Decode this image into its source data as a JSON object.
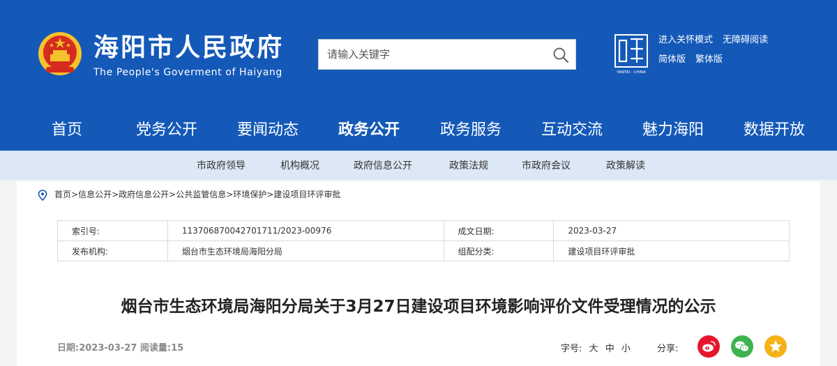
{
  "header": {
    "title": "海阳市人民政府",
    "subtitle": "The People's Goverment of Haiyang",
    "search_placeholder": "请输入关键字",
    "logo_caption": "YANTAI · CHINA",
    "links_row1": [
      "进入关怀模式",
      "无障碍阅读"
    ],
    "links_row2": [
      "简体版",
      "繁体版"
    ]
  },
  "mainnav": [
    "首页",
    "党务公开",
    "要闻动态",
    "政务公开",
    "政务服务",
    "互动交流",
    "魅力海阳",
    "数据开放"
  ],
  "mainnav_active": "政务公开",
  "subnav": [
    "市政府领导",
    "机构概况",
    "政府信息公开",
    "政策法规",
    "市政府会议",
    "政策解读"
  ],
  "breadcrumb": [
    "首页",
    "信息公开",
    "政府信息公开",
    "公共监管信息",
    "环境保护",
    "建设项目环评审批"
  ],
  "meta": {
    "index_label": "索引号:",
    "index_value": "113706870042701711/2023-00976",
    "date_label": "成文日期:",
    "date_value": "2023-03-27",
    "publisher_label": "发布机构:",
    "publisher_value": "烟台市生态环境局海阳分局",
    "category_label": "组配分类:",
    "category_value": "建设项目环评审批"
  },
  "article": {
    "title": "烟台市生态环境局海阳分局关于3月27日建设项目环境影响评价文件受理情况的公示",
    "info": "日期:2023-03-27 阅读量:15",
    "fontsize_label": "字号:",
    "fontsize_options": [
      "大",
      "中",
      "小"
    ],
    "share_label": "分享:"
  },
  "colors": {
    "brand_blue": "#1459b8",
    "subnav_bg": "#dce8f6",
    "weibo": "#e6162d",
    "wechat": "#3fb34f",
    "qzone": "#f5b216"
  },
  "icons": [
    "national-emblem-icon",
    "search-icon",
    "yantai-logo-icon",
    "location-pin-icon",
    "weibo-icon",
    "wechat-icon",
    "qzone-icon"
  ]
}
